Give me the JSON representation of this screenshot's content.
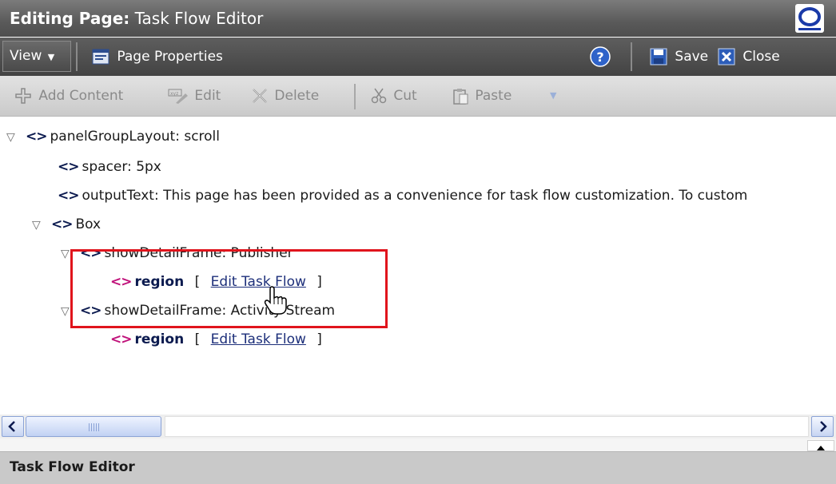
{
  "window": {
    "title_prefix": "Editing Page:",
    "title_name": "Task Flow Editor"
  },
  "menubar": {
    "view_label": "View",
    "page_properties_label": "Page Properties",
    "save_label": "Save",
    "close_label": "Close"
  },
  "toolbar": {
    "add_content_label": "Add Content",
    "edit_label": "Edit",
    "delete_label": "Delete",
    "cut_label": "Cut",
    "paste_label": "Paste"
  },
  "tree": {
    "panel": "panelGroupLayout: scroll",
    "spacer": "spacer: 5px",
    "output_text": "outputText: This page has been provided as a convenience for task flow customization. To custom",
    "box": "Box",
    "publisher_frame": "showDetailFrame: Publisher",
    "activity_frame": "showDetailFrame: Activity Stream",
    "region_label": "region",
    "edit_task_flow": "Edit Task Flow",
    "bracket_open": "[",
    "bracket_close": "]"
  },
  "status": {
    "title": "Task Flow Editor"
  },
  "colors": {
    "highlight_border": "#e0141c",
    "region_icon": "#c0117a",
    "tag_icon": "#0b1a4f"
  }
}
